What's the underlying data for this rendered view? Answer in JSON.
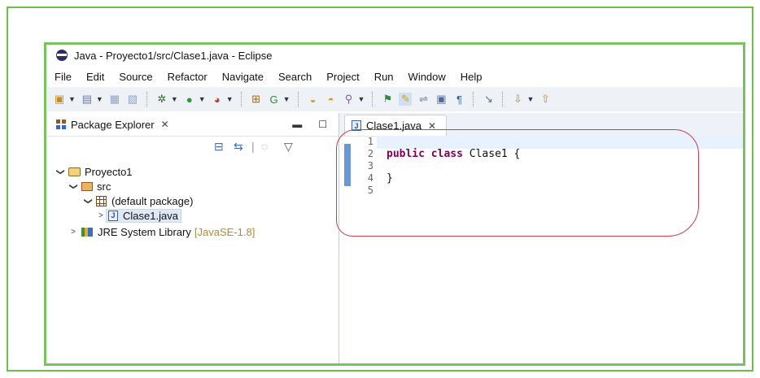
{
  "window": {
    "title": "Java - Proyecto1/src/Clase1.java - Eclipse"
  },
  "menu": [
    "File",
    "Edit",
    "Source",
    "Refactor",
    "Navigate",
    "Search",
    "Project",
    "Run",
    "Window",
    "Help"
  ],
  "left_panel": {
    "tab_label": "Package Explorer",
    "close_icon": "✕",
    "tree": {
      "project": "Proyecto1",
      "src": "src",
      "package": "(default package)",
      "file": "Clase1.java",
      "jre": "JRE System Library",
      "jre_version": "[JavaSE-1.8]"
    }
  },
  "editor": {
    "tab_label": "Clase1.java",
    "close_icon": "✕",
    "line_numbers": [
      "1",
      "2",
      "3",
      "4",
      "5"
    ],
    "lines": {
      "l2_kw1": "public",
      "l2_kw2": "class",
      "l2_rest": " Clase1 {",
      "l4": "}"
    }
  },
  "colors": {
    "frame_green": "#6cc04a",
    "annotation_red": "#c0414a",
    "keyword": "#7f0055"
  }
}
